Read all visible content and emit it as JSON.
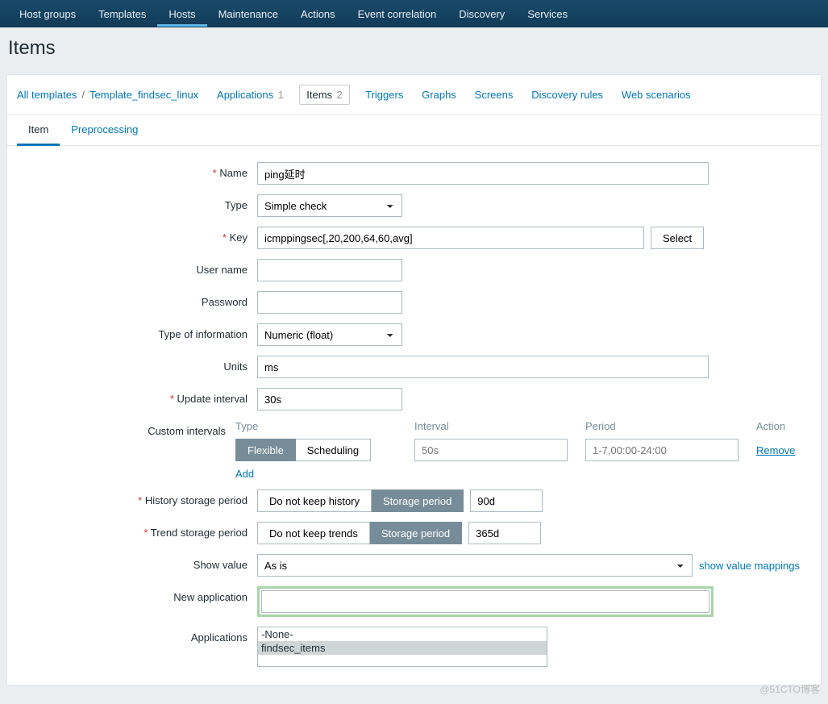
{
  "nav": [
    "Host groups",
    "Templates",
    "Hosts",
    "Maintenance",
    "Actions",
    "Event correlation",
    "Discovery",
    "Services"
  ],
  "nav_active": 2,
  "page_title": "Items",
  "breadcrumb": {
    "all": "All templates",
    "template": "Template_findsec_linux",
    "apps_label": "Applications",
    "apps_count": "1",
    "items_label": "Items",
    "items_count": "2",
    "triggers": "Triggers",
    "graphs": "Graphs",
    "screens": "Screens",
    "discovery": "Discovery rules",
    "web": "Web scenarios"
  },
  "tabs": {
    "item": "Item",
    "preproc": "Preprocessing"
  },
  "form": {
    "name_label": "Name",
    "name_value": "ping延时",
    "type_label": "Type",
    "type_value": "Simple check",
    "key_label": "Key",
    "key_value": "icmppingsec[,20,200,64,60,avg]",
    "select_btn": "Select",
    "username_label": "User name",
    "username_value": "",
    "password_label": "Password",
    "password_value": "",
    "typeinfo_label": "Type of information",
    "typeinfo_value": "Numeric (float)",
    "units_label": "Units",
    "units_value": "ms",
    "update_label": "Update interval",
    "update_value": "30s",
    "ci_label": "Custom intervals",
    "ci_head_type": "Type",
    "ci_head_int": "Interval",
    "ci_head_per": "Period",
    "ci_head_act": "Action",
    "ci_flex": "Flexible",
    "ci_sched": "Scheduling",
    "ci_int_ph": "50s",
    "ci_per_ph": "1-7,00:00-24:00",
    "ci_remove": "Remove",
    "ci_add": "Add",
    "hist_label": "History storage period",
    "hist_no": "Do not keep history",
    "hist_sp": "Storage period",
    "hist_val": "90d",
    "trend_label": "Trend storage period",
    "trend_no": "Do not keep trends",
    "trend_sp": "Storage period",
    "trend_val": "365d",
    "show_label": "Show value",
    "show_value": "As is",
    "show_link": "show value mappings",
    "newapp_label": "New application",
    "newapp_value": "",
    "apps_label": "Applications",
    "apps_opts": [
      "-None-",
      "findsec_items"
    ],
    "apps_sel": 1
  },
  "watermark": "@51CTO博客"
}
